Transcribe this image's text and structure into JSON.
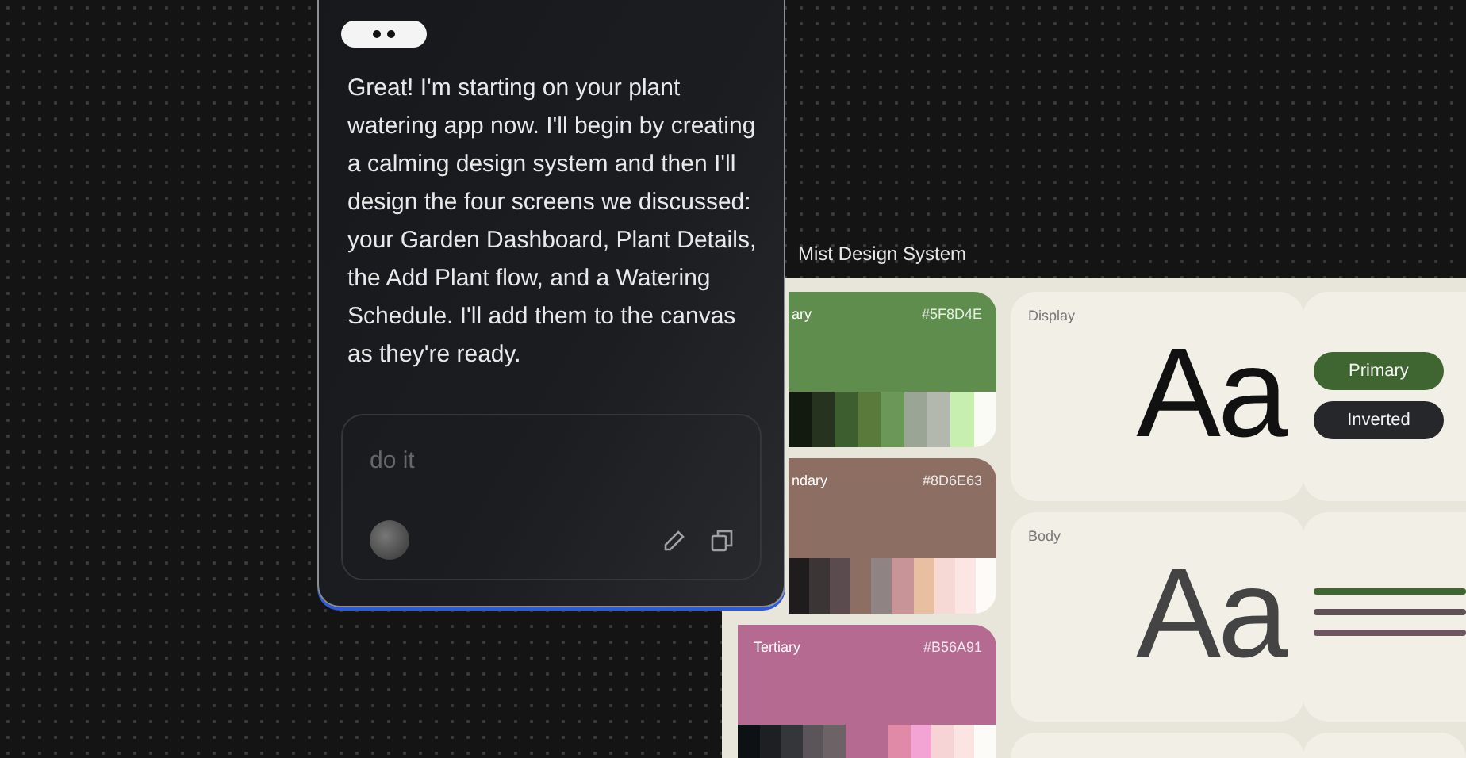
{
  "chat": {
    "message": "Great! I'm starting on your plant watering app now. I'll begin by creating a calming design system and then I'll design the four screens we discussed: your Garden Dashboard, Plant Details, the Add Plant flow, and a Watering Schedule. I'll add them to the canvas as they're ready.",
    "input": {
      "placeholder": "do it"
    }
  },
  "board": {
    "title": "Mist Design System",
    "palettes": [
      {
        "name": "ary",
        "hex": "#5F8D4E",
        "color": "#5f8d4e",
        "swatches": [
          {
            "color": "#121a10"
          },
          {
            "color": "#26331f"
          },
          {
            "color": "#3d5e2e"
          },
          {
            "color": "#5a7a3c"
          },
          {
            "color": "#6b9858"
          },
          {
            "color": "#9ba595"
          },
          {
            "color": "#b2b8ad"
          },
          {
            "color": "#c7f0b0"
          },
          {
            "color": "#fbfbf6"
          }
        ]
      },
      {
        "name": "ndary",
        "hex": "#8D6E63",
        "color": "#8d6e63",
        "swatches": [
          {
            "color": "#1e1c1c"
          },
          {
            "color": "#3b3536"
          },
          {
            "color": "#5b4a4e"
          },
          {
            "color": "#8d6e63"
          },
          {
            "color": "#8f8384"
          },
          {
            "color": "#c89497"
          },
          {
            "color": "#e8bfa1"
          },
          {
            "color": "#f6d8d5"
          },
          {
            "color": "#fbe6e3"
          },
          {
            "color": "#fdfbf8"
          }
        ]
      },
      {
        "name": "Tertiary",
        "hex": "#B56A91",
        "color": "#b56a91",
        "swatches": [
          {
            "color": "#0e1114"
          },
          {
            "color": "#1e1f22"
          },
          {
            "color": "#35363a"
          },
          {
            "color": "#5b5458"
          },
          {
            "color": "#6d6266"
          },
          {
            "color": "#b56a91"
          },
          {
            "color": "#b56a91"
          },
          {
            "color": "#e08aa8"
          },
          {
            "color": "#f3a3d4"
          },
          {
            "color": "#f6d4d6"
          },
          {
            "color": "#fbe4e2"
          },
          {
            "color": "#fdfbf8"
          }
        ]
      }
    ],
    "type_samples": [
      {
        "label": "Display",
        "sample": "Aa",
        "kind": "display"
      },
      {
        "label": "Body",
        "sample": "Aa",
        "kind": "body"
      }
    ],
    "buttons": [
      {
        "label": "Primary",
        "color": "#3f6530"
      },
      {
        "label": "Inverted",
        "color": "#25272a"
      }
    ]
  }
}
